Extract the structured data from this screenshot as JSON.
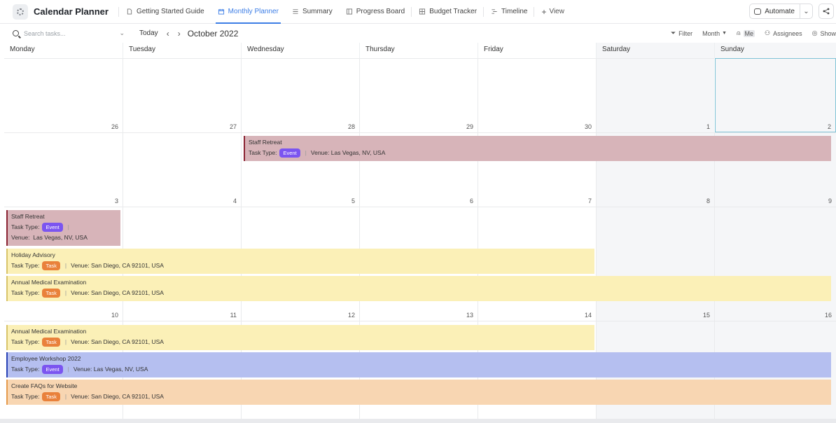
{
  "app": {
    "title": "Calendar Planner"
  },
  "tabs": [
    {
      "label": "Getting Started Guide",
      "icon": "doc-icon"
    },
    {
      "label": "Monthly Planner",
      "icon": "calendar-icon",
      "active": true
    },
    {
      "label": "Summary",
      "icon": "list-icon"
    },
    {
      "label": "Progress Board",
      "icon": "board-icon"
    },
    {
      "label": "Budget Tracker",
      "icon": "table-icon"
    },
    {
      "label": "Timeline",
      "icon": "timeline-icon"
    }
  ],
  "add_view_label": "View",
  "automate_label": "Automate",
  "toolbar": {
    "search_placeholder": "Search tasks...",
    "today_label": "Today",
    "month_label": "October 2022",
    "filter_label": "Filter",
    "month_select": "Month",
    "me_label": "Me",
    "assignees_label": "Assignees",
    "show_label": "Show"
  },
  "days": [
    "Monday",
    "Tuesday",
    "Wednesday",
    "Thursday",
    "Friday",
    "Saturday",
    "Sunday"
  ],
  "weeks": [
    [
      "26",
      "27",
      "28",
      "29",
      "30",
      "1",
      "2"
    ],
    [
      "3",
      "4",
      "5",
      "6",
      "7",
      "8",
      "9"
    ],
    [
      "10",
      "11",
      "12",
      "13",
      "14",
      "15",
      "16"
    ],
    [
      "",
      "",
      "",
      "",
      "",
      "",
      ""
    ]
  ],
  "labels": {
    "task_type": "Task Type:",
    "venue": "Venue:"
  },
  "events": {
    "staff_retreat_w2": {
      "title": "Staff Retreat",
      "type": "Event",
      "venue": "Las Vegas, NV, USA"
    },
    "staff_retreat_w3": {
      "title": "Staff Retreat",
      "type": "Event",
      "venue": "Las Vegas, NV, USA"
    },
    "holiday_advisory": {
      "title": "Holiday Advisory",
      "type": "Task",
      "venue": "San Diego, CA 92101, USA"
    },
    "annual_medical_w3": {
      "title": "Annual Medical Examination",
      "type": "Task",
      "venue": "San Diego, CA 92101, USA"
    },
    "annual_medical_w4": {
      "title": "Annual Medical Examination",
      "type": "Task",
      "venue": "San Diego, CA 92101, USA"
    },
    "employee_workshop": {
      "title": "Employee Workshop 2022",
      "type": "Event",
      "venue": "Las Vegas, NV, USA"
    },
    "create_faqs": {
      "title": "Create FAQs for Website",
      "type": "Task",
      "venue": "San Diego, CA 92101, USA"
    }
  },
  "colors": {
    "accent": "#3d7ee6",
    "event_badge": "#7b55f0",
    "task_badge": "#e9813b"
  }
}
